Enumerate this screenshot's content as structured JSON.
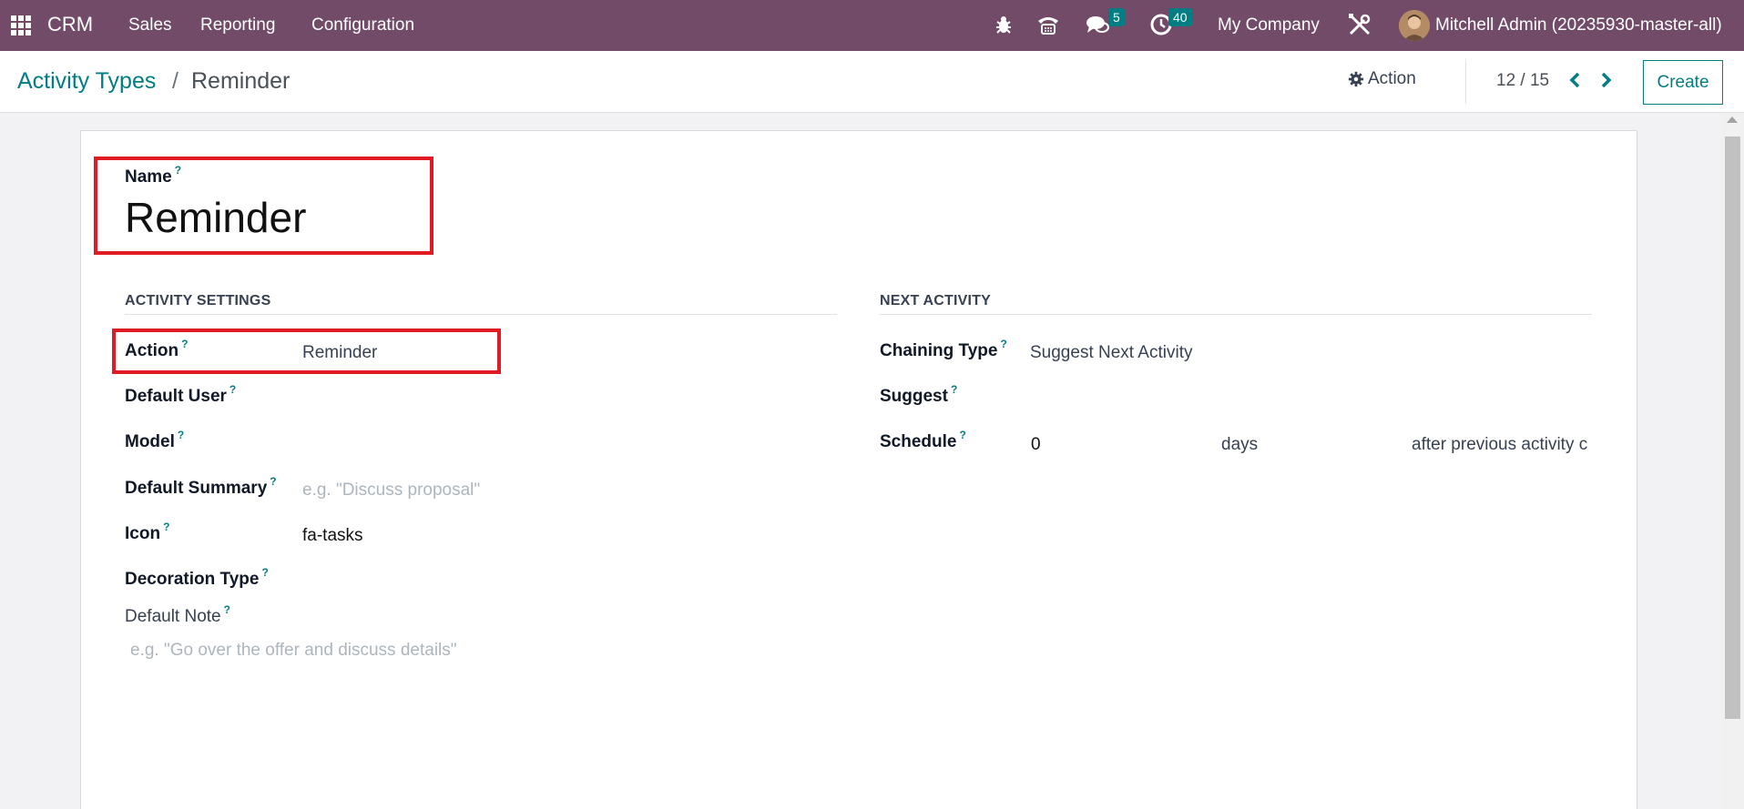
{
  "navbar": {
    "app_name": "CRM",
    "menus": [
      "Sales",
      "Reporting",
      "Configuration"
    ],
    "messages_count": "5",
    "activities_count": "40",
    "company": "My Company",
    "user": "Mitchell Admin (20235930-master-all)",
    "icons": [
      "apps-grid-icon",
      "bug-icon",
      "phone-icon",
      "chat-icon",
      "clock-icon",
      "tools-icon"
    ]
  },
  "control_panel": {
    "breadcrumb_parent": "Activity Types",
    "breadcrumb_separator": "/",
    "breadcrumb_current": "Reminder",
    "action_label": "Action",
    "pager": "12 / 15",
    "create_label": "Create"
  },
  "form": {
    "name_label": "Name",
    "name_value": "Reminder",
    "help_mark": "?",
    "activity_settings": {
      "title": "ACTIVITY SETTINGS",
      "action_label": "Action",
      "action_value": "Reminder",
      "default_user_label": "Default User",
      "model_label": "Model",
      "default_summary_label": "Default Summary",
      "default_summary_placeholder": "e.g. \"Discuss proposal\"",
      "icon_label": "Icon",
      "icon_value": "fa-tasks",
      "decoration_type_label": "Decoration Type",
      "default_note_label": "Default Note",
      "default_note_placeholder": "e.g. \"Go over the offer and discuss details\""
    },
    "next_activity": {
      "title": "NEXT ACTIVITY",
      "chaining_type_label": "Chaining Type",
      "chaining_type_value": "Suggest Next Activity",
      "suggest_label": "Suggest",
      "schedule_label": "Schedule",
      "schedule_value": "0",
      "schedule_unit": "days",
      "schedule_from": "after previous activity c"
    }
  },
  "colors": {
    "navbar": "#714b67",
    "accent": "#017e84",
    "highlight": "#e01b24"
  }
}
